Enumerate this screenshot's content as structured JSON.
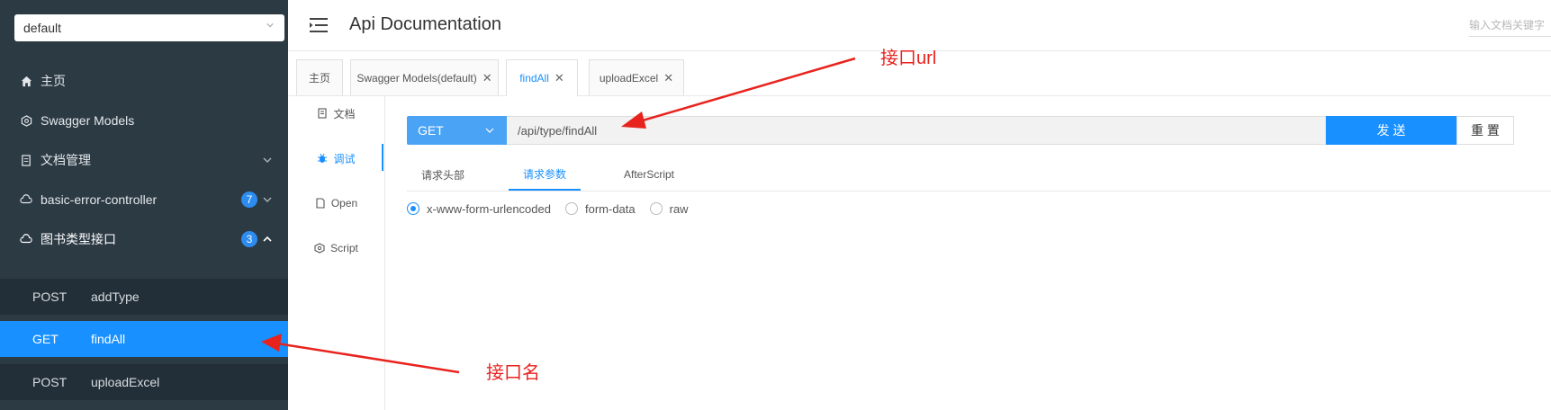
{
  "sidebar": {
    "group_select": "default",
    "items": [
      {
        "label": "主页",
        "icon": "home-icon"
      },
      {
        "label": "Swagger Models",
        "icon": "settings-icon"
      },
      {
        "label": "文档管理",
        "icon": "document-icon"
      },
      {
        "label": "basic-error-controller",
        "icon": "cloud-icon",
        "badge": "7"
      },
      {
        "label": "图书类型接口",
        "icon": "cloud-icon",
        "badge": "3"
      }
    ],
    "sub_items": [
      {
        "method": "POST",
        "name": "addType"
      },
      {
        "method": "GET",
        "name": "findAll",
        "active": true
      },
      {
        "method": "POST",
        "name": "uploadExcel"
      }
    ]
  },
  "header": {
    "title": "Api Documentation",
    "search_placeholder": "输入文档关键字"
  },
  "tabs": [
    {
      "label": "主页"
    },
    {
      "label": "Swagger Models(default)"
    },
    {
      "label": "findAll",
      "active": true
    },
    {
      "label": "uploadExcel"
    }
  ],
  "vtabs": [
    {
      "label": "文档",
      "icon": "document-icon"
    },
    {
      "label": "调试",
      "icon": "bug-icon",
      "active": true
    },
    {
      "label": "Open",
      "icon": "file-icon"
    },
    {
      "label": "Script",
      "icon": "code-icon"
    }
  ],
  "debug": {
    "method": "GET",
    "url": "/api/type/findAll",
    "send_label": "发 送",
    "reset_label": "重 置",
    "request_tabs": [
      "请求头部",
      "请求参数",
      "AfterScript"
    ],
    "active_request_tab": "请求参数",
    "content_types": [
      "x-www-form-urlencoded",
      "form-data",
      "raw"
    ],
    "selected_content_type": "x-www-form-urlencoded"
  },
  "annotations": {
    "url_label": "接口url",
    "name_label": "接口名",
    "color": "#e8231e"
  },
  "colors": {
    "accent": "#1890ff",
    "sidebar_bg": "#2c3a44"
  }
}
